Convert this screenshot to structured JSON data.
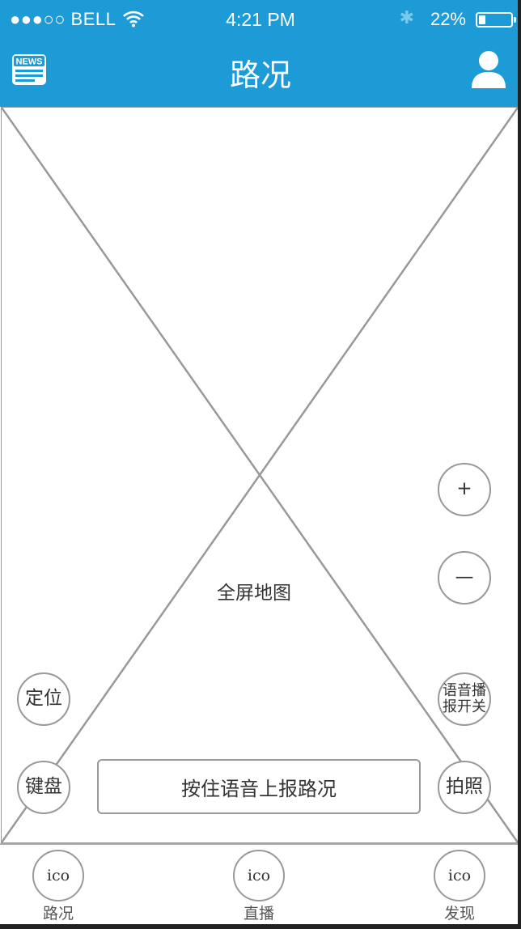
{
  "status_bar": {
    "carrier": "●●●○○ BELL",
    "time": "4:21 PM",
    "battery_percent": "22%",
    "battery_level": 0.22,
    "bluetooth_glyph": "✱",
    "wifi_icon": "wifi-icon"
  },
  "nav": {
    "title": "路况",
    "left_icon": "news-icon",
    "left_icon_text": "NEWS",
    "right_icon": "user-icon"
  },
  "map": {
    "label": "全屏地图"
  },
  "controls": {
    "zoom_in": "+",
    "zoom_out": "—",
    "locate": "定位",
    "voice_toggle_line1": "语音播",
    "voice_toggle_line2": "报开关",
    "keyboard": "键盘",
    "photo": "拍照",
    "report": "按住语音上报路况"
  },
  "tabs": [
    {
      "icon_text": "ico",
      "label": "路况"
    },
    {
      "icon_text": "ico",
      "label": "直播"
    },
    {
      "icon_text": "ico",
      "label": "发现"
    }
  ],
  "colors": {
    "accent": "#1c9bd6",
    "border": "#999999"
  }
}
